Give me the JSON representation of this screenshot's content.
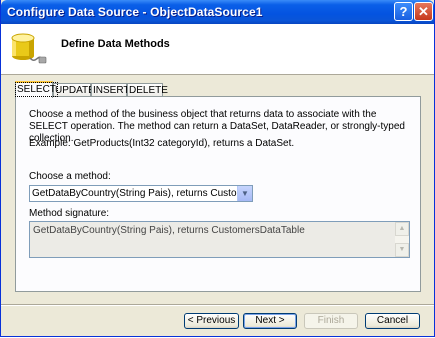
{
  "window": {
    "title": "Configure Data Source - ObjectDataSource1",
    "help_label": "?",
    "close_label": "✕"
  },
  "header": {
    "title": "Define Data Methods",
    "icon": "database-icon"
  },
  "tabs": [
    {
      "label": "SELECT",
      "active": true
    },
    {
      "label": "UPDATE",
      "active": false
    },
    {
      "label": "INSERT",
      "active": false
    },
    {
      "label": "DELETE",
      "active": false
    }
  ],
  "select_panel": {
    "description": "Choose a method of the business object that returns data to associate with the SELECT operation. The method can return a DataSet, DataReader, or strongly-typed collection.",
    "example": "Example: GetProducts(Int32 categoryId), returns a DataSet.",
    "choose_label": "Choose a method:",
    "method_value": "GetDataByCountry(String Pais), returns CustomersDataTable",
    "signature_label": "Method signature:",
    "signature_value": "GetDataByCountry(String Pais), returns CustomersDataTable"
  },
  "buttons": {
    "previous": "< Previous",
    "next": "Next >",
    "finish": "Finish",
    "cancel": "Cancel"
  },
  "colors": {
    "title_bar": "#0453e0",
    "dialog_bg": "#ece9d8",
    "active_tab_accent": "#ffc83c"
  }
}
